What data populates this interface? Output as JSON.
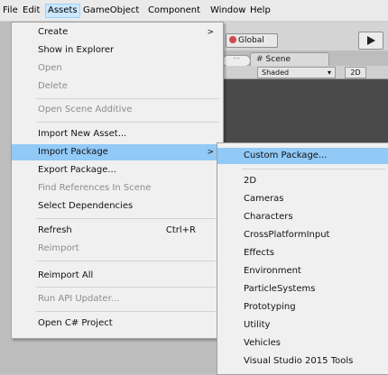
{
  "menubar": {
    "items": [
      "File",
      "Edit",
      "Assets",
      "GameObject",
      "Component",
      "Window",
      "Help"
    ]
  },
  "toolbar": {
    "global_label": "Global"
  },
  "scene": {
    "tab_label": "Scene",
    "shading_mode": "Shaded",
    "mode_2d": "2D"
  },
  "assets_menu": {
    "items": [
      {
        "label": "Create",
        "arrow": ">"
      },
      {
        "label": "Show in Explorer"
      },
      {
        "label": "Open"
      },
      {
        "label": "Delete"
      },
      {
        "label": "Open Scene Additive"
      },
      {
        "label": "Import New Asset..."
      },
      {
        "label": "Import Package",
        "arrow": ">"
      },
      {
        "label": "Export Package..."
      },
      {
        "label": "Find References In Scene"
      },
      {
        "label": "Select Dependencies"
      },
      {
        "label": "Refresh",
        "shortcut": "Ctrl+R"
      },
      {
        "label": "Reimport"
      },
      {
        "label": "Reimport All"
      },
      {
        "label": "Run API Updater..."
      },
      {
        "label": "Open C# Project"
      }
    ]
  },
  "import_package_menu": {
    "items": [
      {
        "label": "Custom Package..."
      },
      {
        "label": "2D"
      },
      {
        "label": "Cameras"
      },
      {
        "label": "Characters"
      },
      {
        "label": "CrossPlatformInput"
      },
      {
        "label": "Effects"
      },
      {
        "label": "Environment"
      },
      {
        "label": "ParticleSystems"
      },
      {
        "label": "Prototyping"
      },
      {
        "label": "Utility"
      },
      {
        "label": "Vehicles"
      },
      {
        "label": "Visual Studio 2015 Tools"
      }
    ]
  }
}
